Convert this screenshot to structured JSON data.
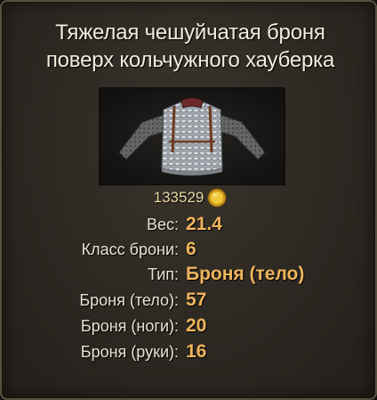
{
  "item": {
    "title_line1": "Тяжелая чешуйчатая броня",
    "title_line2": "поверх кольчужного хауберка",
    "image_icon": "armor-item-image",
    "price": "133529",
    "currency_icon": "gold-coin-icon"
  },
  "stats": [
    {
      "label": "Вес:",
      "value": "21.4"
    },
    {
      "label": "Класс брони:",
      "value": "6"
    },
    {
      "label": "Тип:",
      "value": "Броня (тело)"
    },
    {
      "label": "Броня (тело):",
      "value": "57"
    },
    {
      "label": "Броня (ноги):",
      "value": "20"
    },
    {
      "label": "Броня (руки):",
      "value": "16"
    }
  ],
  "colors": {
    "title_text": "#f3ecdd",
    "label_text": "#e9e1cf",
    "value_text": "#f0b45c",
    "price_text": "#ead7a3",
    "panel_bg": "#2c2822",
    "border": "#57503f"
  }
}
